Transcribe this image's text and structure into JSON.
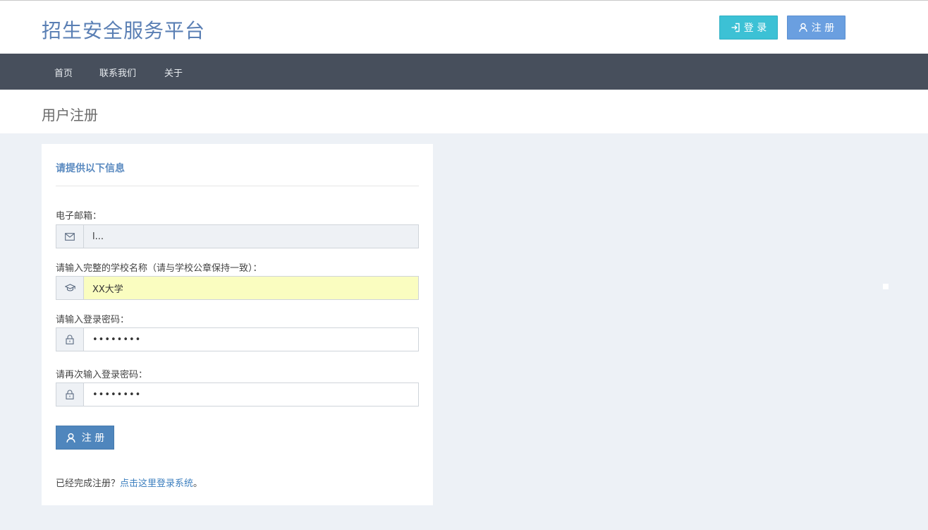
{
  "header": {
    "brand": "招生安全服务平台",
    "login_label": "登 录",
    "register_label": "注 册",
    "login_color": "#3cc1d5",
    "register_color": "#6a9fe0",
    "icons": [
      "sign-in-icon",
      "user-icon"
    ]
  },
  "nav": {
    "items": [
      {
        "label": "首页"
      },
      {
        "label": "联系我们"
      },
      {
        "label": "关于"
      }
    ],
    "background": "#474f5c"
  },
  "page": {
    "title": "用户注册"
  },
  "form": {
    "heading": "请提供以下信息",
    "email": {
      "label": "电子邮箱：",
      "value": "l...",
      "icon": "envelope-icon",
      "disabled": true
    },
    "school": {
      "label": "请输入完整的学校名称（请与学校公章保持一致）：",
      "value": "XX大学",
      "icon": "graduation-cap-icon"
    },
    "password": {
      "label": "请输入登录密码：",
      "value": "12345678",
      "icon": "lock-icon"
    },
    "password_confirm": {
      "label": "请再次输入登录密码：",
      "value": "12345678",
      "icon": "lock-icon"
    },
    "submit_label": "注 册",
    "footer_prefix": "已经完成注册？",
    "footer_link": "点击这里登录系统",
    "footer_suffix": "。"
  }
}
